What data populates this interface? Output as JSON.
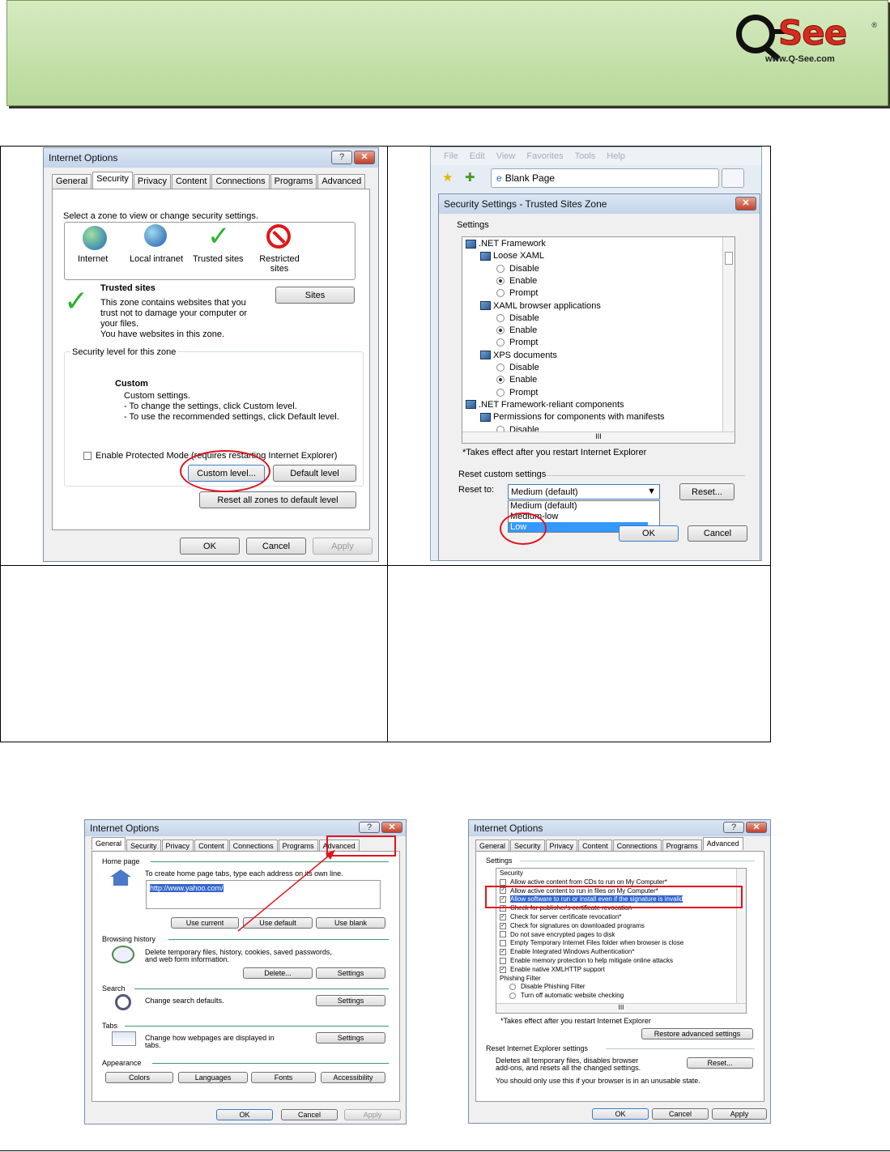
{
  "logo": {
    "brand": "See",
    "url": "www.Q-See.com",
    "reg": "®"
  },
  "dlg1": {
    "title": "Internet Options",
    "tabs": [
      "General",
      "Security",
      "Privacy",
      "Content",
      "Connections",
      "Programs",
      "Advanced"
    ],
    "zone_prompt": "Select a zone to view or change security settings.",
    "zones": [
      "Internet",
      "Local intranet",
      "Trusted sites",
      "Restricted sites"
    ],
    "zone_heading": "Trusted sites",
    "zone_desc": [
      "This zone contains websites that you",
      "trust not to damage your computer or",
      "your files.",
      "You have websites in this zone."
    ],
    "sites_btn": "Sites",
    "level_label": "Security level for this zone",
    "custom_title": "Custom",
    "custom_lines": [
      "Custom settings.",
      "- To change the settings, click Custom level.",
      "- To use the recommended settings, click Default level."
    ],
    "protected_mode": "Enable Protected Mode (requires restarting Internet Explorer)",
    "custom_level_btn": "Custom level...",
    "default_level_btn": "Default level",
    "reset_all_btn": "Reset all zones to default level",
    "ok": "OK",
    "cancel": "Cancel",
    "apply": "Apply"
  },
  "dlg2": {
    "menu": [
      "File",
      "Edit",
      "View",
      "Favorites",
      "Tools",
      "Help"
    ],
    "tab_label": "Blank Page",
    "title": "Security Settings - Trusted Sites Zone",
    "settings_label": "Settings",
    "tree": [
      {
        "t": "icon",
        "label": ".NET Framework",
        "indent": 0
      },
      {
        "t": "icon",
        "label": "Loose XAML",
        "indent": 1
      },
      {
        "t": "radio",
        "label": "Disable",
        "on": false
      },
      {
        "t": "radio",
        "label": "Enable",
        "on": true
      },
      {
        "t": "radio",
        "label": "Prompt",
        "on": false
      },
      {
        "t": "icon",
        "label": "XAML browser applications",
        "indent": 1
      },
      {
        "t": "radio",
        "label": "Disable",
        "on": false
      },
      {
        "t": "radio",
        "label": "Enable",
        "on": true
      },
      {
        "t": "radio",
        "label": "Prompt",
        "on": false
      },
      {
        "t": "icon",
        "label": "XPS documents",
        "indent": 1
      },
      {
        "t": "radio",
        "label": "Disable",
        "on": false
      },
      {
        "t": "radio",
        "label": "Enable",
        "on": true
      },
      {
        "t": "radio",
        "label": "Prompt",
        "on": false
      },
      {
        "t": "icon",
        "label": ".NET Framework-reliant components",
        "indent": 0
      },
      {
        "t": "icon",
        "label": "Permissions for components with manifests",
        "indent": 1
      },
      {
        "t": "radio",
        "label": "Disable",
        "on": false
      }
    ],
    "scroll_mid": "III",
    "restart_note": "*Takes effect after you restart Internet Explorer",
    "reset_custom": "Reset custom settings",
    "reset_to": "Reset to:",
    "selected": "Medium (default)",
    "reset_btn": "Reset...",
    "options": [
      "Medium (default)",
      "Medium-low",
      "Low"
    ],
    "cancel": "Cancel"
  },
  "dlg3": {
    "title": "Internet Options",
    "tabs": [
      "General",
      "Security",
      "Privacy",
      "Content",
      "Connections",
      "Programs",
      "Advanced"
    ],
    "home_label": "Home page",
    "home_desc": "To create home page tabs, type each address on its own line.",
    "home_url": "http://www.yahoo.com/",
    "use_current": "Use current",
    "use_default": "Use default",
    "use_blank": "Use blank",
    "history_label": "Browsing history",
    "history_desc": [
      "Delete temporary files, history, cookies, saved passwords,",
      "and web form information."
    ],
    "delete_btn": "Delete...",
    "settings_btn": "Settings",
    "search_label": "Search",
    "search_desc": "Change search defaults.",
    "tabs_label": "Tabs",
    "tabs_desc": [
      "Change how webpages are displayed in",
      "tabs."
    ],
    "appearance_label": "Appearance",
    "colors": "Colors",
    "languages": "Languages",
    "fonts": "Fonts",
    "accessibility": "Accessibility",
    "ok": "OK",
    "cancel": "Cancel",
    "apply": "Apply"
  },
  "dlg4": {
    "title": "Internet Options",
    "tabs": [
      "General",
      "Security",
      "Privacy",
      "Content",
      "Connections",
      "Programs",
      "Advanced"
    ],
    "settings_label": "Settings",
    "items": [
      {
        "t": "head",
        "label": "Security"
      },
      {
        "t": "chk",
        "label": "Allow active content from CDs to run on My Computer*",
        "on": false
      },
      {
        "t": "chk",
        "label": "Allow active content to run in files on My Computer*",
        "on": true
      },
      {
        "t": "chk",
        "label": "Allow software to run or install even if the signature is invalid",
        "on": true,
        "sel": true
      },
      {
        "t": "chk",
        "label": "Check for publisher's certificate revocation",
        "on": true
      },
      {
        "t": "chk",
        "label": "Check for server certificate revocation*",
        "on": true
      },
      {
        "t": "chk",
        "label": "Check for signatures on downloaded programs",
        "on": true
      },
      {
        "t": "chk",
        "label": "Do not save encrypted pages to disk",
        "on": false
      },
      {
        "t": "chk",
        "label": "Empty Temporary Internet Files folder when browser is close",
        "on": false
      },
      {
        "t": "chk",
        "label": "Enable Integrated Windows Authentication*",
        "on": true
      },
      {
        "t": "chk",
        "label": "Enable memory protection to help mitigate online attacks",
        "on": false
      },
      {
        "t": "chk",
        "label": "Enable native XMLHTTP support",
        "on": true
      },
      {
        "t": "head",
        "label": "Phishing Filter"
      },
      {
        "t": "radio",
        "label": "Disable Phishing Filter",
        "on": false
      },
      {
        "t": "radio",
        "label": "Turn off automatic website checking",
        "on": false
      }
    ],
    "scroll_mid": "III",
    "restart_note": "*Takes effect after you restart Internet Explorer",
    "restore_btn": "Restore advanced settings",
    "reset_label": "Reset Internet Explorer settings",
    "reset_desc": [
      "Deletes all temporary files, disables browser",
      "add-ons, and resets all the changed settings."
    ],
    "reset_btn": "Reset...",
    "unusable": "You should only use this if your browser is in an unusable state.",
    "ok": "OK",
    "cancel": "Cancel",
    "apply": "Apply"
  }
}
